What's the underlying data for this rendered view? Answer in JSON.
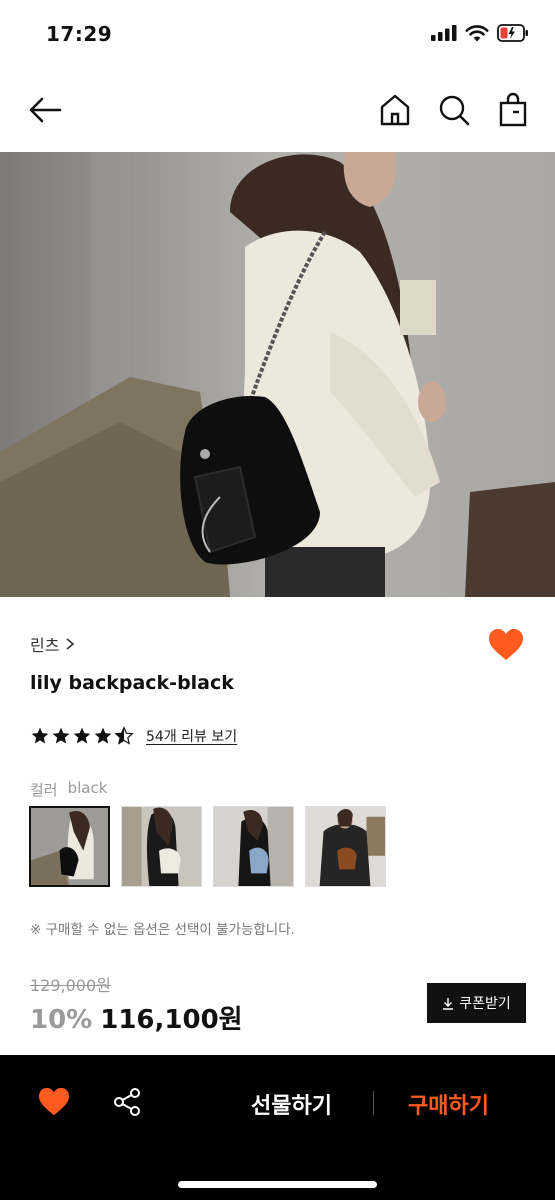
{
  "status_bar": {
    "time": "17:29"
  },
  "product": {
    "brand": "린츠",
    "name": "lily backpack-black",
    "rating": 4.5,
    "review_link": "54개 리뷰 보기",
    "color_label": "컬러",
    "color_value": "black",
    "notice": "※ 구매할 수 없는 옵션은 선택이 불가능합니다.",
    "original_price": "129,000원",
    "discount": "10%",
    "price": "116,100원",
    "coupon_label": "쿠폰받기"
  },
  "bottom_bar": {
    "gift_label": "선물하기",
    "buy_label": "구매하기"
  },
  "colors": {
    "accent": "#ff5a1f",
    "heart": "#ff5a1f",
    "background": "#ffffff",
    "bottom_bar": "#000000"
  },
  "icons": [
    "back-arrow-icon",
    "home-icon",
    "search-icon",
    "shopping-bag-icon",
    "heart-icon",
    "share-icon",
    "chevron-right-icon",
    "star-icon",
    "download-icon"
  ]
}
